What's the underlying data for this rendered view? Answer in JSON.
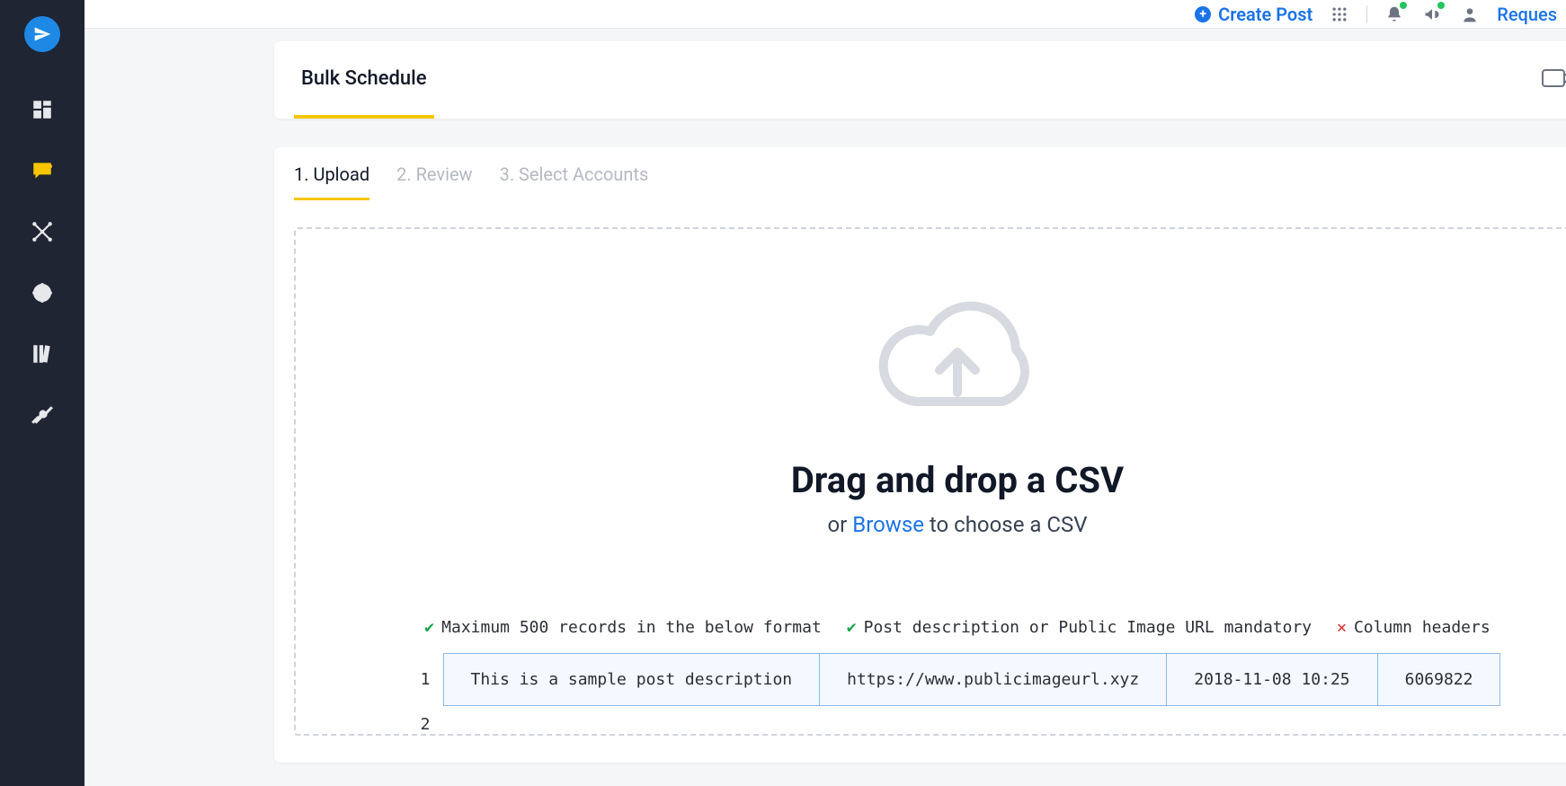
{
  "topbar": {
    "create_post_label": "Create Post",
    "request_label": "Reques"
  },
  "header": {
    "tab_bulk_schedule": "Bulk Schedule",
    "help_label": "?"
  },
  "steps": {
    "s1": "1. Upload",
    "s2": "2. Review",
    "s3": "3. Select Accounts"
  },
  "dropzone": {
    "title": "Drag and drop a CSV",
    "sub_prefix": "or ",
    "browse": "Browse",
    "sub_suffix": " to choose a CSV"
  },
  "rules": {
    "r1": "Maximum 500 records in the below format",
    "r2": "Post description or Public Image URL mandatory",
    "r3": "Column headers"
  },
  "sample": {
    "rows": [
      {
        "num": "1",
        "cells": [
          "This is a sample post description",
          "https://www.publicimageurl.xyz",
          "2018-11-08 10:25",
          "6069822"
        ]
      },
      {
        "num": "2",
        "cells": []
      }
    ]
  },
  "sidebar": {
    "items": [
      "dashboard",
      "posts",
      "connections",
      "target",
      "library",
      "tools"
    ]
  }
}
